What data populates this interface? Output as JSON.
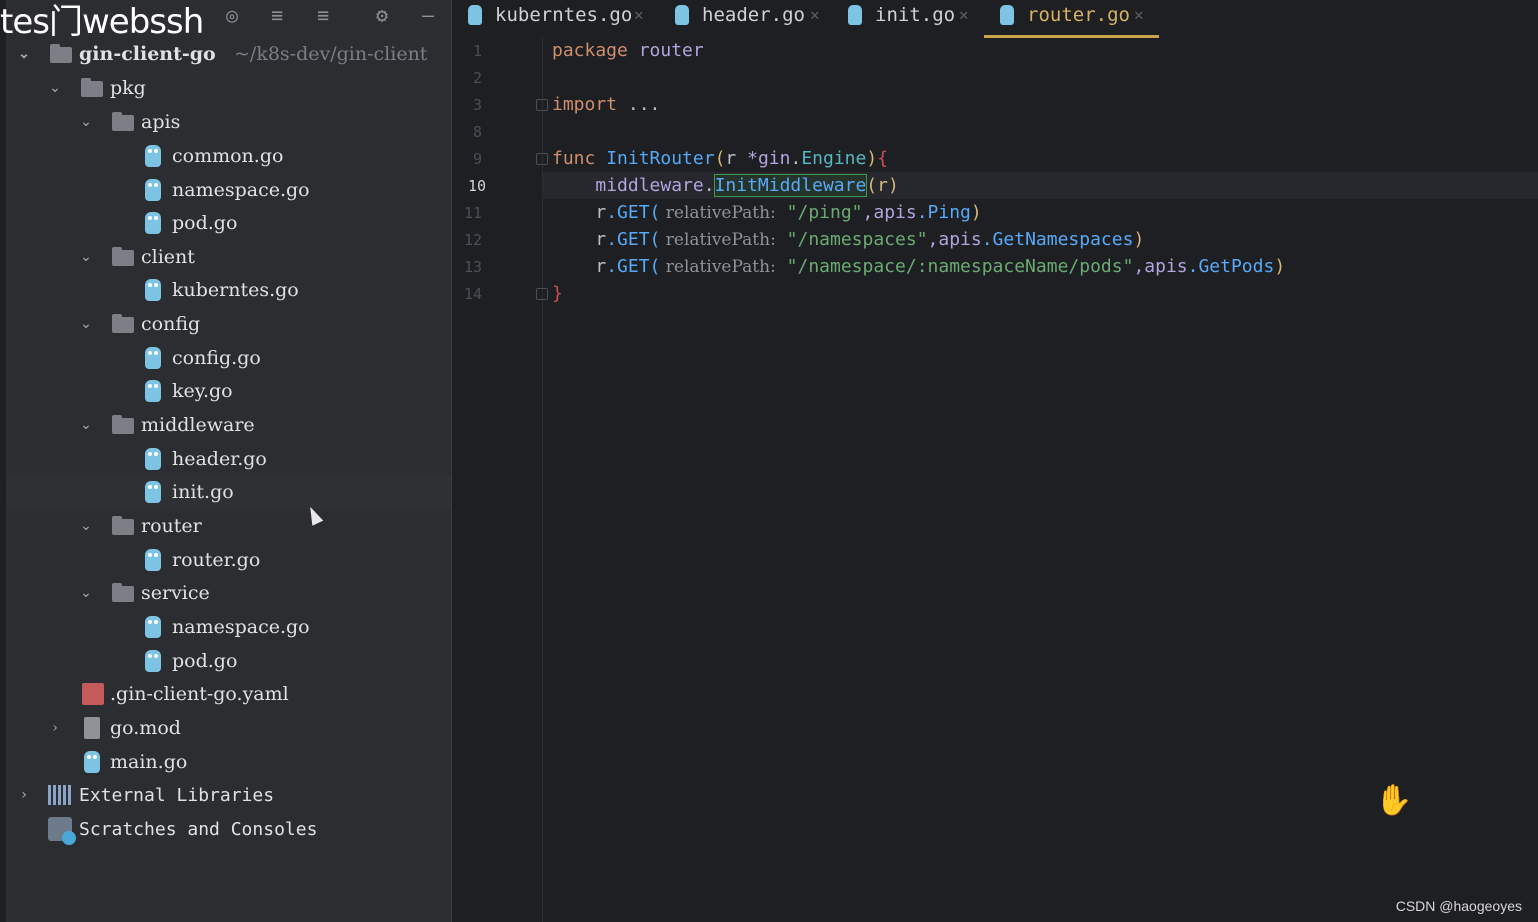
{
  "watermark": "tes门webssh",
  "toolbar": {
    "icons": [
      "target-icon",
      "expand-all-icon",
      "collapse-all-icon",
      "gear-icon",
      "minimize-icon"
    ]
  },
  "project": {
    "root": {
      "name": "gin-client-go",
      "path": "~/k8s-dev/gin-client"
    },
    "pkg": "pkg",
    "apis": "apis",
    "apis_files": [
      "common.go",
      "namespace.go",
      "pod.go"
    ],
    "client": "client",
    "client_files": [
      "kuberntes.go"
    ],
    "config": "config",
    "config_files": [
      "config.go",
      "key.go"
    ],
    "middleware": "middleware",
    "middleware_files": [
      "header.go",
      "init.go"
    ],
    "router": "router",
    "router_files": [
      "router.go"
    ],
    "service": "service",
    "service_files": [
      "namespace.go",
      "pod.go"
    ],
    "yaml": ".gin-client-go.yaml",
    "gomod": "go.mod",
    "main": "main.go",
    "external": "External Libraries",
    "scratches": "Scratches and Consoles"
  },
  "tabs": [
    {
      "label": "kuberntes.go",
      "active": false
    },
    {
      "label": "header.go",
      "active": false
    },
    {
      "label": "init.go",
      "active": false
    },
    {
      "label": "router.go",
      "active": true
    }
  ],
  "editor": {
    "line_numbers": [
      "1",
      "2",
      "3",
      "8",
      "9",
      "10",
      "11",
      "12",
      "13",
      "14"
    ],
    "current_line": "10",
    "code": {
      "l1_kw": "package",
      "l1_name": "router",
      "l3_kw": "import",
      "l3_rest": " ...",
      "l9_kw": "func",
      "l9_fn": "InitRouter",
      "l9_open": "(",
      "l9_param": "r ",
      "l9_type": "*gin",
      "l9_dot": ".",
      "l9_engine": "Engine",
      "l9_close": ")",
      "l9_brace": "{",
      "l10_pkg": "middleware",
      "l10_dot": ".",
      "l10_fn": "InitMiddleware",
      "l10_args": "(r)",
      "get_recv": "r",
      "get_method": ".GET(",
      "hint": " relativePath:",
      "l11_str": " \"/ping\"",
      "l11_pkg": ",apis",
      "l11_fn": ".Ping",
      "l11_close": ")",
      "l12_str": " \"/namespaces\"",
      "l12_pkg": ",apis",
      "l12_fn": ".GetNamespaces",
      "l12_close": ")",
      "l13_str": " \"/namespace/:namespaceName/pods\"",
      "l13_pkg": ",apis",
      "l13_fn": ".GetPods",
      "l13_close": ")",
      "l14_brace": "}"
    }
  },
  "credit": "CSDN @haogeoyes"
}
